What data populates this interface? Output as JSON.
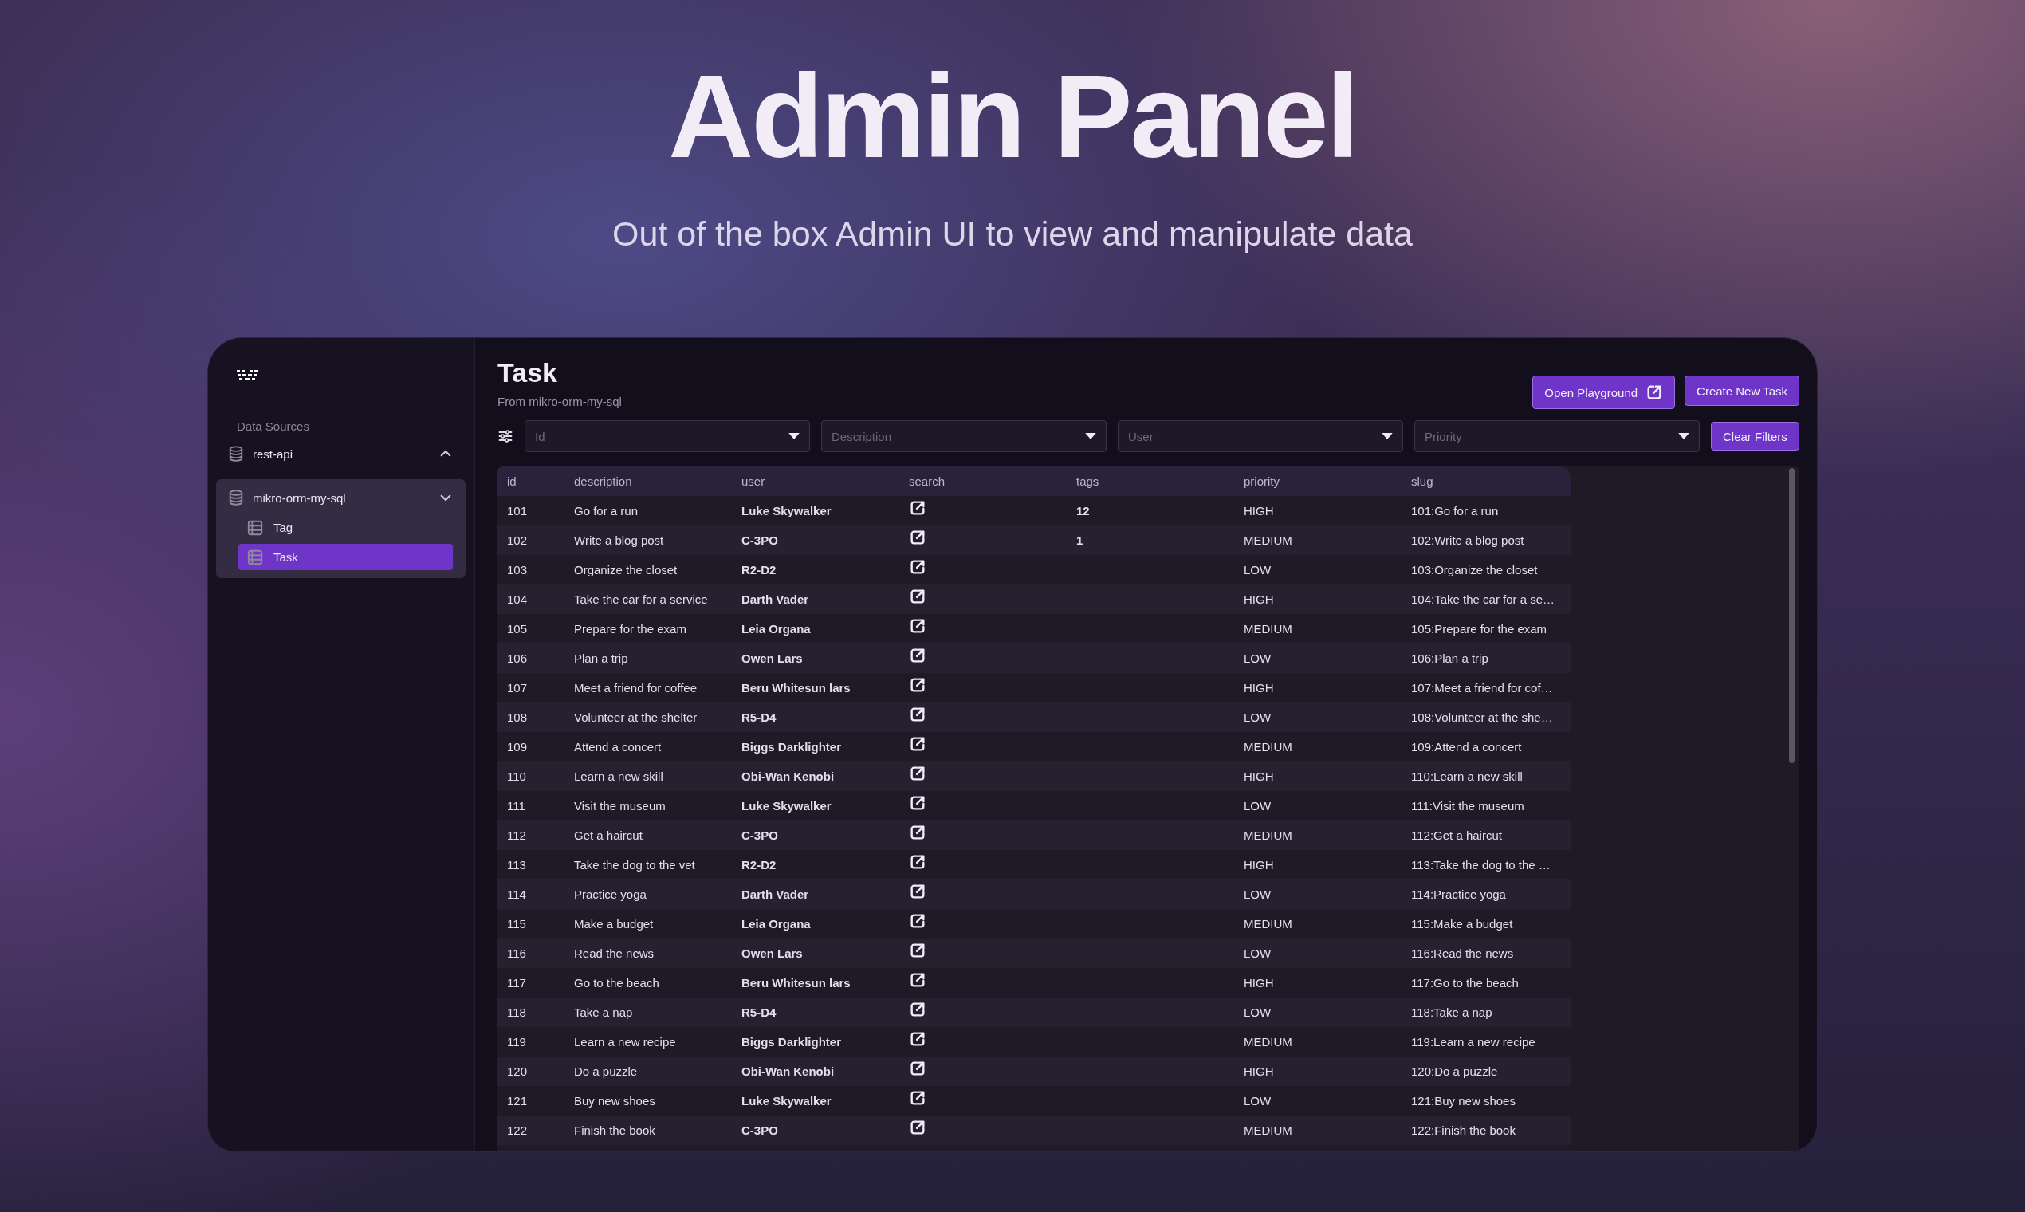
{
  "hero": {
    "title": "Admin Panel",
    "subtitle": "Out of the box Admin UI to view and manipulate data"
  },
  "sidebar": {
    "section_label": "Data Sources",
    "sources": [
      {
        "name": "rest-api",
        "expanded": false
      },
      {
        "name": "mikro-orm-my-sql",
        "expanded": true,
        "children": [
          {
            "name": "Tag",
            "selected": false
          },
          {
            "name": "Task",
            "selected": true
          }
        ]
      }
    ]
  },
  "header": {
    "title": "Task",
    "subtitle": "From mikro-orm-my-sql",
    "buttons": [
      {
        "label": "Open Playground",
        "kind": "external"
      },
      {
        "label": "Create New Task",
        "kind": "plain"
      }
    ]
  },
  "filters": [
    {
      "placeholder": "Id"
    },
    {
      "placeholder": "Description"
    },
    {
      "placeholder": "User"
    },
    {
      "placeholder": "Priority"
    }
  ],
  "clear_button": "Clear Filters",
  "table": {
    "columns": [
      "id",
      "description",
      "user",
      "search",
      "tags",
      "priority",
      "slug"
    ],
    "rows": [
      {
        "id": "101",
        "description": "Go for a run",
        "user": "Luke Skywalker",
        "tags": "12",
        "priority": "HIGH",
        "slug": "101:Go for a run"
      },
      {
        "id": "102",
        "description": "Write a blog post",
        "user": "C-3PO",
        "tags": "1",
        "priority": "MEDIUM",
        "slug": "102:Write a blog post"
      },
      {
        "id": "103",
        "description": "Organize the closet",
        "user": "R2-D2",
        "priority": "LOW",
        "slug": "103:Organize the closet"
      },
      {
        "id": "104",
        "description": "Take the car for a service",
        "user": "Darth Vader",
        "priority": "HIGH",
        "slug": "104:Take the car for a se…"
      },
      {
        "id": "105",
        "description": "Prepare for the exam",
        "user": "Leia Organa",
        "priority": "MEDIUM",
        "slug": "105:Prepare for the exam"
      },
      {
        "id": "106",
        "description": "Plan a trip",
        "user": "Owen Lars",
        "priority": "LOW",
        "slug": "106:Plan a trip"
      },
      {
        "id": "107",
        "description": "Meet a friend for coffee",
        "user": "Beru Whitesun lars",
        "priority": "HIGH",
        "slug": "107:Meet a friend for cof…"
      },
      {
        "id": "108",
        "description": "Volunteer at the shelter",
        "user": "R5-D4",
        "priority": "LOW",
        "slug": "108:Volunteer at the she…"
      },
      {
        "id": "109",
        "description": "Attend a concert",
        "user": "Biggs Darklighter",
        "priority": "MEDIUM",
        "slug": "109:Attend a concert"
      },
      {
        "id": "110",
        "description": "Learn a new skill",
        "user": "Obi-Wan Kenobi",
        "priority": "HIGH",
        "slug": "110:Learn a new skill"
      },
      {
        "id": "111",
        "description": "Visit the museum",
        "user": "Luke Skywalker",
        "priority": "LOW",
        "slug": "111:Visit the museum"
      },
      {
        "id": "112",
        "description": "Get a haircut",
        "user": "C-3PO",
        "priority": "MEDIUM",
        "slug": "112:Get a haircut"
      },
      {
        "id": "113",
        "description": "Take the dog to the vet",
        "user": "R2-D2",
        "priority": "HIGH",
        "slug": "113:Take the dog to the …"
      },
      {
        "id": "114",
        "description": "Practice yoga",
        "user": "Darth Vader",
        "priority": "LOW",
        "slug": "114:Practice yoga"
      },
      {
        "id": "115",
        "description": "Make a budget",
        "user": "Leia Organa",
        "priority": "MEDIUM",
        "slug": "115:Make a budget"
      },
      {
        "id": "116",
        "description": "Read the news",
        "user": "Owen Lars",
        "priority": "LOW",
        "slug": "116:Read the news"
      },
      {
        "id": "117",
        "description": "Go to the beach",
        "user": "Beru Whitesun lars",
        "priority": "HIGH",
        "slug": "117:Go to the beach"
      },
      {
        "id": "118",
        "description": "Take a nap",
        "user": "R5-D4",
        "priority": "LOW",
        "slug": "118:Take a nap"
      },
      {
        "id": "119",
        "description": "Learn a new recipe",
        "user": "Biggs Darklighter",
        "priority": "MEDIUM",
        "slug": "119:Learn a new recipe"
      },
      {
        "id": "120",
        "description": "Do a puzzle",
        "user": "Obi-Wan Kenobi",
        "priority": "HIGH",
        "slug": "120:Do a puzzle"
      },
      {
        "id": "121",
        "description": "Buy new shoes",
        "user": "Luke Skywalker",
        "priority": "LOW",
        "slug": "121:Buy new shoes"
      },
      {
        "id": "122",
        "description": "Finish the book",
        "user": "C-3PO",
        "priority": "MEDIUM",
        "slug": "122:Finish the book"
      }
    ]
  }
}
